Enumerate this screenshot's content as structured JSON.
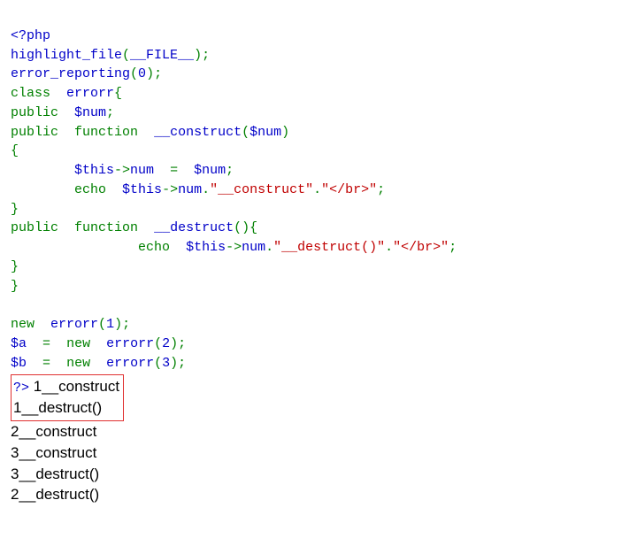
{
  "code": {
    "l1": {
      "open": "<?php"
    },
    "l2": {
      "fn": "highlight_file",
      "lp": "(",
      "arg": "__FILE__",
      "rp": ")",
      "semi": ";"
    },
    "l3": {
      "fn": "error_reporting",
      "lp": "(",
      "arg": "0",
      "rp": ")",
      "semi": ";"
    },
    "l4": {
      "kw": "class",
      "sp": "  ",
      "name": "errorr",
      "brace": "{"
    },
    "l5": {
      "kw": "public",
      "sp": "  ",
      "var": "$num",
      "semi": ";"
    },
    "l6": {
      "kw": "public",
      "sp1": "  ",
      "kw2": "function",
      "sp2": "  ",
      "fn": "__construct",
      "lp": "(",
      "arg": "$num",
      "rp": ")"
    },
    "l7": {
      "brace": "{"
    },
    "l8": {
      "indent": "        ",
      "this": "$this",
      "arrow": "->",
      "prop": "num",
      "sp": "  ",
      "eq": "=",
      "sp2": "  ",
      "var": "$num",
      "semi": ";"
    },
    "l9": {
      "indent": "        ",
      "echo": "echo",
      "sp": "  ",
      "this": "$this",
      "arrow": "->",
      "prop": "num",
      "dot1": ".",
      "str1": "\"__construct\"",
      "dot2": ".",
      "str2": "\"</br>\"",
      "semi": ";"
    },
    "l10": {
      "brace": "}"
    },
    "l11": {
      "kw": "public",
      "sp1": "  ",
      "kw2": "function",
      "sp2": "  ",
      "fn": "__destruct",
      "lp": "(",
      "rp": ")",
      "brace": "{"
    },
    "l12": {
      "indent": "                ",
      "echo": "echo",
      "sp": "  ",
      "this": "$this",
      "arrow": "->",
      "prop": "num",
      "dot1": ".",
      "str1": "\"__destruct()\"",
      "dot2": ".",
      "str2": "\"</br>\"",
      "semi": ";"
    },
    "l13": {
      "brace": "}"
    },
    "l14": {
      "brace": "}"
    },
    "blank": "",
    "l16": {
      "kw": "new",
      "sp": "  ",
      "cls": "errorr",
      "lp": "(",
      "arg": "1",
      "rp": ")",
      "semi": ";"
    },
    "l17": {
      "var": "$a",
      "sp1": "  ",
      "eq": "=",
      "sp2": "  ",
      "kw": "new",
      "sp3": "  ",
      "cls": "errorr",
      "lp": "(",
      "arg": "2",
      "rp": ")",
      "semi": ";"
    },
    "l18": {
      "var": "$b",
      "sp1": "  ",
      "eq": "=",
      "sp2": "  ",
      "kw": "new",
      "sp3": "  ",
      "cls": "errorr",
      "lp": "(",
      "arg": "3",
      "rp": ")",
      "semi": ";"
    },
    "close": "?>"
  },
  "output": {
    "o1": "1__construct",
    "o2": "1__destruct()",
    "o3": "2__construct",
    "o4": "3__construct",
    "o5": "3__destruct()",
    "o6": "2__destruct()"
  }
}
